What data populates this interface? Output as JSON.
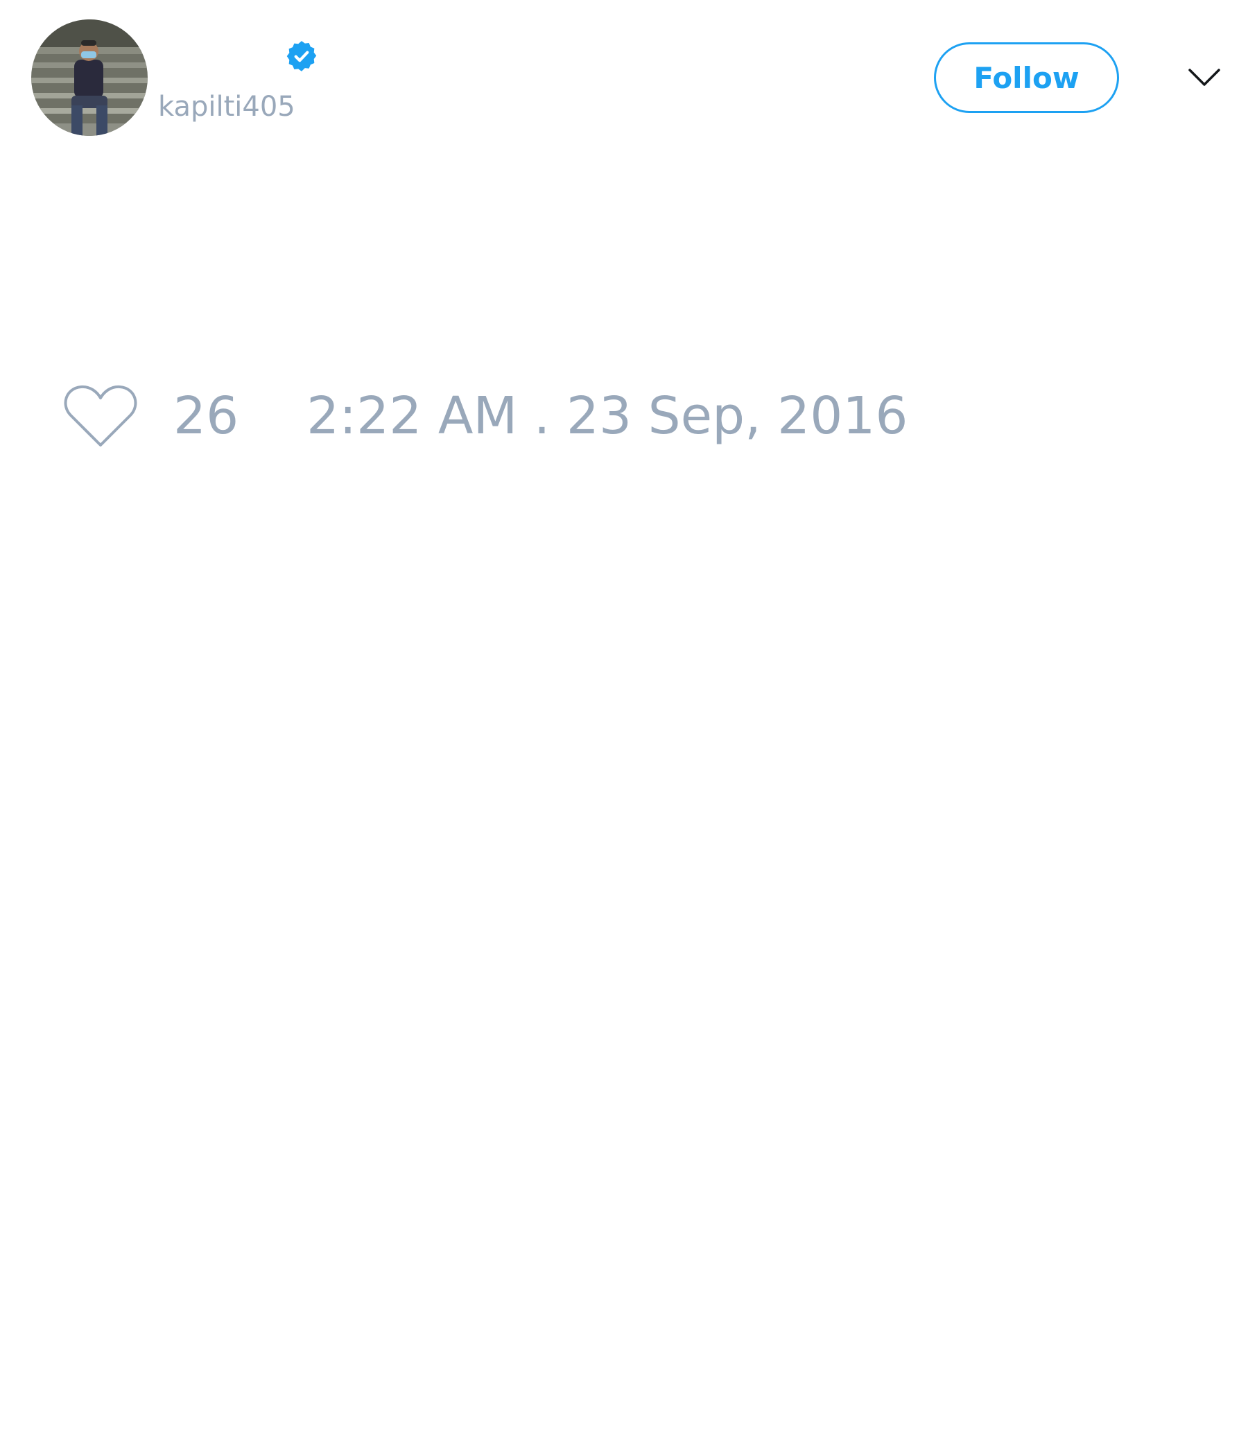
{
  "user": {
    "display_name": "",
    "handle": "kapilti405",
    "verified": true,
    "avatar_icon": "profile-photo"
  },
  "actions": {
    "follow_label": "Follow",
    "menu_icon": "chevron-down-icon"
  },
  "stats": {
    "like_icon": "heart-icon",
    "like_count": "26",
    "timestamp": "2:22 AM . 23 Sep, 2016"
  },
  "colors": {
    "accent": "#1da1f2",
    "muted_text": "#99a8ba",
    "background": "#ffffff"
  }
}
